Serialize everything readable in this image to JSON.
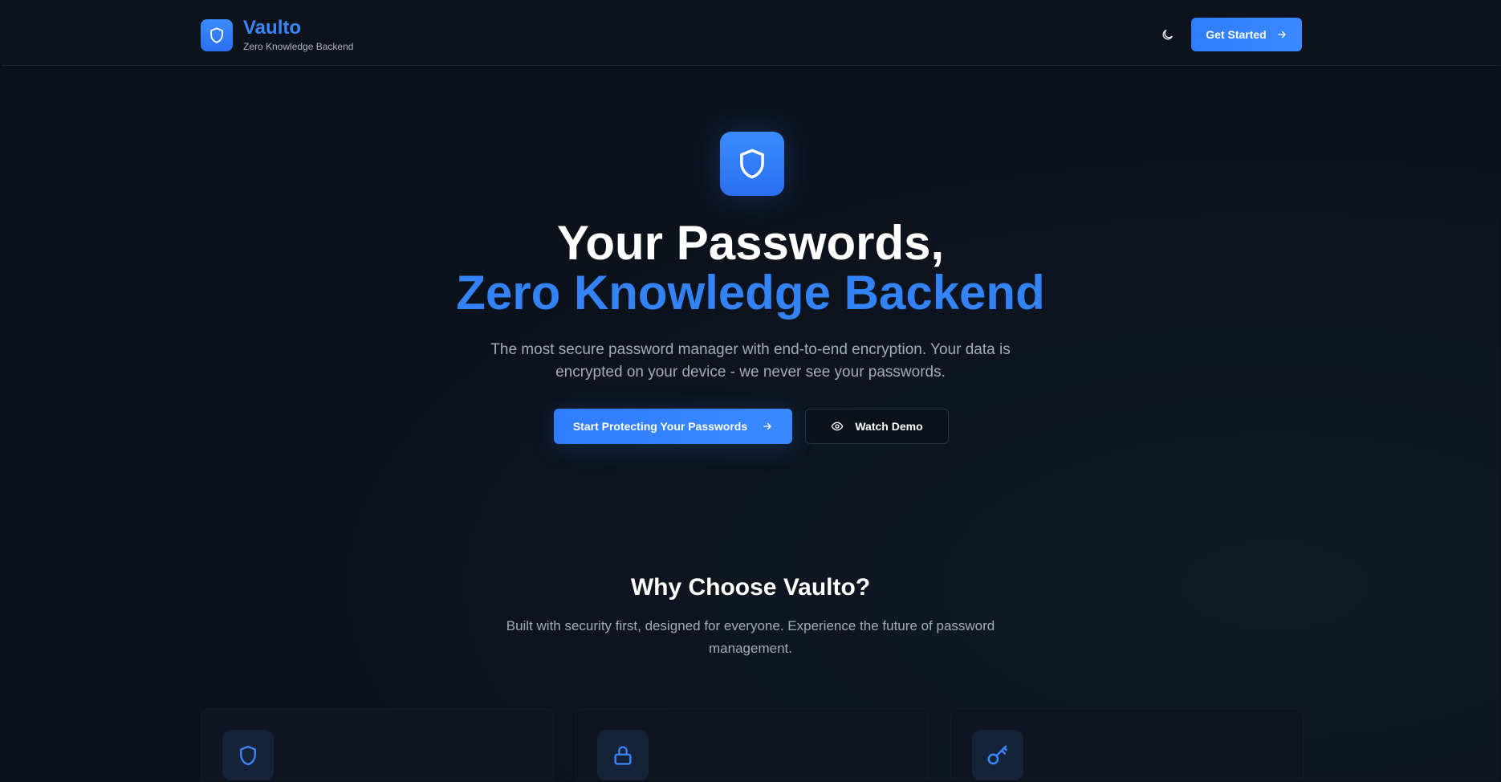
{
  "header": {
    "brand_name": "Vaulto",
    "brand_tagline": "Zero Knowledge Backend",
    "cta_label": "Get Started",
    "icons": {
      "logo": "shield-icon",
      "theme": "moon-icon",
      "cta": "arrow-right-icon"
    }
  },
  "hero": {
    "title_line1": "Your Passwords,",
    "title_line2": "Zero Knowledge Backend",
    "description": "The most secure password manager with end-to-end encryption. Your data is encrypted on your device - we never see your passwords.",
    "primary_label": "Start Protecting Your Passwords",
    "secondary_label": "Watch Demo",
    "icons": {
      "hero": "shield-icon",
      "primary": "arrow-right-icon",
      "secondary": "eye-icon"
    }
  },
  "features": {
    "title": "Why Choose Vaulto?",
    "description": "Built with security first, designed for everyone. Experience the future of password management.",
    "cards": [
      {
        "icon": "shield-icon"
      },
      {
        "icon": "lock-icon"
      },
      {
        "icon": "key-icon"
      }
    ]
  },
  "colors": {
    "background": "#0c121c",
    "accent": "#3382f6",
    "text_primary": "#ffffff",
    "text_muted": "#a2acbb"
  }
}
